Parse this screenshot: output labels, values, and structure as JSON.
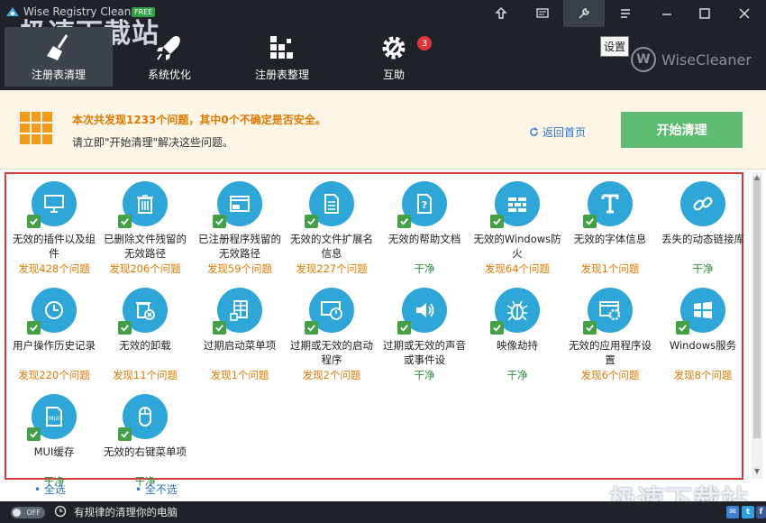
{
  "window": {
    "title": "Wise Registry Cleaner 9",
    "badge": "FREE",
    "watermark_top": "极速下载站",
    "watermark_bottom": "极速下载站"
  },
  "nav": [
    {
      "label": "注册表清理",
      "icon": "broom-icon",
      "active": true
    },
    {
      "label": "系统优化",
      "icon": "rocket-icon",
      "active": false
    },
    {
      "label": "注册表整理",
      "icon": "blocks-icon",
      "active": false
    },
    {
      "label": "互助",
      "icon": "gear-icon",
      "active": false,
      "badge": "3"
    }
  ],
  "tooltip": {
    "settings": "设置"
  },
  "brand": {
    "mark": "W",
    "name": "WiseCleaner"
  },
  "summary": {
    "line1": "本次共发现1233个问题，其中0个不确定是否安全。",
    "line2": "请立即\"开始清理\"解决这些问题。",
    "back_link": "返回首页",
    "start_button": "开始清理"
  },
  "items": [
    {
      "name": "无效的插件以及组件",
      "status": "发现428个问题",
      "kind": "found",
      "icon": "monitor-icon"
    },
    {
      "name": "已删除文件残留的无效路径",
      "status": "发现206个问题",
      "kind": "found",
      "icon": "trash-icon"
    },
    {
      "name": "已注册程序残留的无效路径",
      "status": "发现59个问题",
      "kind": "found",
      "icon": "window-icon"
    },
    {
      "name": "无效的文件扩展名信息",
      "status": "发现227个问题",
      "kind": "found",
      "icon": "document-icon"
    },
    {
      "name": "无效的帮助文档",
      "status": "干净",
      "kind": "clean",
      "icon": "help-document-icon"
    },
    {
      "name": "无效的Windows防火",
      "status": "发现64个问题",
      "kind": "found",
      "icon": "firewall-icon"
    },
    {
      "name": "无效的字体信息",
      "status": "发现1个问题",
      "kind": "found",
      "icon": "font-icon"
    },
    {
      "name": "丢失的动态链接库",
      "status": "干净",
      "kind": "clean",
      "icon": "link-icon"
    },
    {
      "name": "用户操作历史记录",
      "status": "发现220个问题",
      "kind": "found",
      "icon": "history-icon"
    },
    {
      "name": "无效的卸载",
      "status": "发现11个问题",
      "kind": "found",
      "icon": "uninstall-icon"
    },
    {
      "name": "过期启动菜单项",
      "status": "发现1个问题",
      "kind": "found",
      "icon": "start-menu-icon"
    },
    {
      "name": "过期或无效的启动程序",
      "status": "发现2个问题",
      "kind": "found",
      "icon": "power-icon"
    },
    {
      "name": "过期或无效的声音或事件设",
      "status": "干净",
      "kind": "clean",
      "icon": "speaker-icon"
    },
    {
      "name": "映像劫持",
      "status": "干净",
      "kind": "clean",
      "icon": "bug-icon"
    },
    {
      "name": "无效的应用程序设置",
      "status": "发现6个问题",
      "kind": "found",
      "icon": "app-settings-icon"
    },
    {
      "name": "Windows服务",
      "status": "发现8个问题",
      "kind": "found",
      "icon": "windows-icon"
    },
    {
      "name": "MUI缓存",
      "status": "干净",
      "kind": "clean",
      "icon": "mui-icon"
    },
    {
      "name": "无效的右键菜单项",
      "status": "干净",
      "kind": "clean",
      "icon": "mouse-icon"
    }
  ],
  "mui_glyph": "MUI",
  "selection": {
    "select_all": "全选",
    "select_none": "全不选"
  },
  "statusbar": {
    "toggle": "OFF",
    "text": "有规律的清理你的电脑"
  },
  "colors": {
    "accent": "#2ea6d8",
    "found": "#e07a00",
    "clean": "#2c8a3a",
    "start": "#5fba72",
    "frame": "#d93a3a"
  }
}
